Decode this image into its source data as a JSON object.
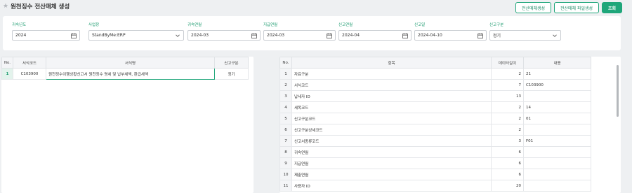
{
  "page_title": "원천징수 전산매체 생성",
  "buttons": {
    "create": "전산매체생성",
    "file_create": "전산매체 파일생성",
    "search": "조회"
  },
  "filters": [
    {
      "label": "귀속년도",
      "value": "2024",
      "icon": "calendar-icon"
    },
    {
      "label": "사업장",
      "value": "StandByMe:ERP",
      "icon": "chevron-down-icon"
    },
    {
      "label": "귀속연월",
      "value": "2024-03",
      "icon": "calendar-icon"
    },
    {
      "label": "지급연월",
      "value": "2024-03",
      "icon": "calendar-icon"
    },
    {
      "label": "신고연월",
      "value": "2024-04",
      "icon": "calendar-icon"
    },
    {
      "label": "신고일",
      "value": "2024-04-10",
      "icon": "calendar-icon"
    },
    {
      "label": "신고구분",
      "value": "정기",
      "icon": "chevron-down-icon"
    }
  ],
  "left_table": {
    "headers": [
      "No.",
      "서식코드",
      "서식명",
      "신고구분"
    ],
    "rows": [
      [
        "1",
        "C103900",
        "원천징수이행상황신고서 원천징수 명세 및 납부세액, 환급세액",
        "정기"
      ]
    ]
  },
  "right_table": {
    "headers": [
      "No.",
      "항목",
      "데이터길이",
      "내용"
    ],
    "rows": [
      [
        "1",
        "자료구분",
        "2",
        "21"
      ],
      [
        "2",
        "서식코드",
        "7",
        "C103900"
      ],
      [
        "3",
        "납세자 ID",
        "13",
        ""
      ],
      [
        "4",
        "세목코드",
        "2",
        "14"
      ],
      [
        "5",
        "신고구분코드",
        "2",
        "01"
      ],
      [
        "6",
        "신고구분상세코드",
        "2",
        ""
      ],
      [
        "7",
        "신고서종류코드",
        "3",
        "F01"
      ],
      [
        "8",
        "귀속연월",
        "6",
        ""
      ],
      [
        "9",
        "지급연월",
        "6",
        ""
      ],
      [
        "10",
        "제출연월",
        "6",
        ""
      ],
      [
        "11",
        "사용자 ID",
        "20",
        ""
      ]
    ]
  }
}
